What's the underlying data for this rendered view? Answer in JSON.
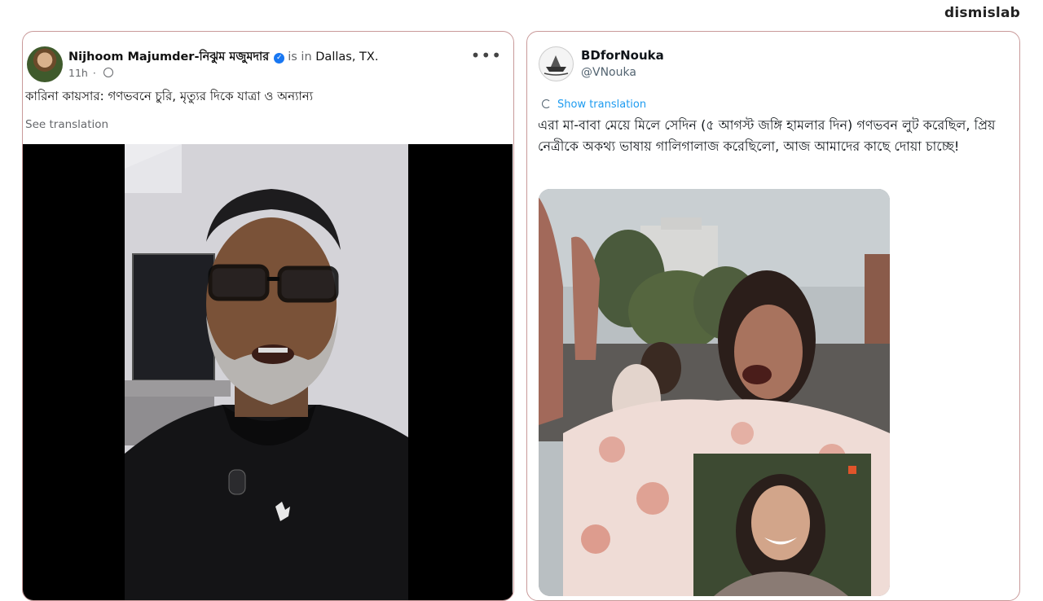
{
  "brand": "dismislab",
  "facebook_post": {
    "author_name": "Nijhoom Majumder-নিঝুম মজুমদার",
    "is_in_label": "is in",
    "location": "Dallas, TX.",
    "time": "11h",
    "text": "কারিনা কায়সার: গণভবনে চুরি, মৃত্যুর দিকে যাত্রা ও অন্যান্য",
    "see_translation": "See translation",
    "more_icon": "more-horizontal-icon",
    "verified_icon": "verified-badge-icon"
  },
  "x_post": {
    "display_name": "BDforNouka",
    "handle": "@VNouka",
    "show_translation": "Show translation",
    "text": "এরা মা-বাবা মেয়ে মিলে সেদিন (৫ আগস্ট জঙ্গি হামলার দিন) গণভবন লুট করেছিল, প্রিয় নেত্রীকে অকথ্য ভাষায় গালিগালাজ করেছিলো, আজ আমাদের কাছে দোয়া চাচ্ছে!"
  },
  "colors": {
    "card_border": "#c99a9a",
    "link_blue": "#1d9bf0",
    "fb_verified": "#1877f2"
  }
}
